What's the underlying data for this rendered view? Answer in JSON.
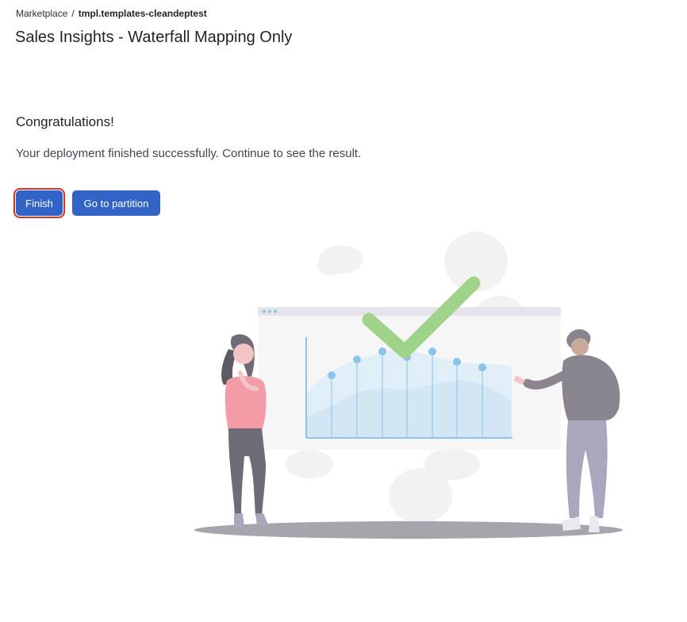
{
  "breadcrumb": {
    "parent": "Marketplace",
    "separator": "/",
    "current": "tmpl.templates-cleandeptest"
  },
  "page": {
    "title": "Sales Insights - Waterfall Mapping Only"
  },
  "result": {
    "heading": "Congratulations!",
    "message": "Your deployment finished successfully. Continue to see the result."
  },
  "actions": {
    "finish_label": "Finish",
    "partition_label": "Go to partition"
  },
  "colors": {
    "primary_button": "#3264c8",
    "highlight_outline": "#d93026",
    "check_mark": "#9fd38a",
    "chart_line": "#8cc4e8"
  },
  "illustration": {
    "icon": "success-illustration"
  }
}
